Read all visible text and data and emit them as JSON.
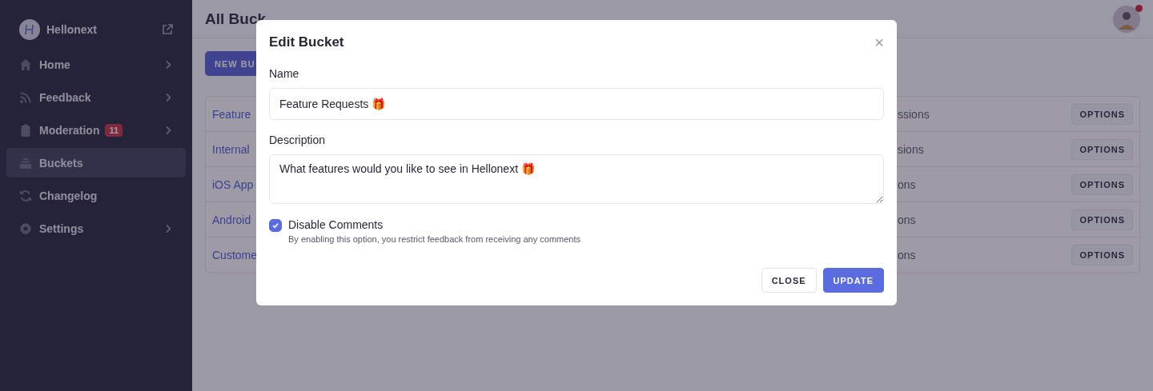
{
  "sidebar": {
    "brand": "Hellonext",
    "items": [
      {
        "label": "Home",
        "selected": false,
        "expandable": true
      },
      {
        "label": "Feedback",
        "selected": false,
        "expandable": true
      },
      {
        "label": "Moderation",
        "selected": false,
        "expandable": true,
        "badge": "11"
      },
      {
        "label": "Buckets",
        "selected": true,
        "expandable": false
      },
      {
        "label": "Changelog",
        "selected": false,
        "expandable": false
      },
      {
        "label": "Settings",
        "selected": false,
        "expandable": true
      }
    ]
  },
  "header": {
    "title": "All Buck",
    "notification": true
  },
  "new_bucket_button": "NEW BU",
  "table": {
    "rows": [
      {
        "column_1": "Feature",
        "column_2": "ssions",
        "action": "OPTIONS"
      },
      {
        "column_1": "Internal",
        "column_2": "sions",
        "action": "OPTIONS"
      },
      {
        "column_1": "iOS App",
        "column_2": "ons",
        "action": "OPTIONS"
      },
      {
        "column_1": "Android",
        "column_2": "ons",
        "action": "OPTIONS"
      },
      {
        "column_1": "Custome",
        "column_2": "ons",
        "action": "OPTIONS"
      }
    ]
  },
  "modal": {
    "title": "Edit Bucket",
    "close": "×",
    "name_label": "Name",
    "name_value": "Feature Requests 🎁",
    "description_label": "Description",
    "description_value": "What features would you like to see in Hellonext 🎁",
    "checkbox": {
      "label": "Disable Comments",
      "hint": "By enabling this option, you restrict feedback from receiving any comments",
      "checked": true
    },
    "buttons": [
      {
        "label": "CLOSE",
        "kind": "secondary"
      },
      {
        "label": "UPDATE",
        "kind": "primary"
      }
    ]
  }
}
